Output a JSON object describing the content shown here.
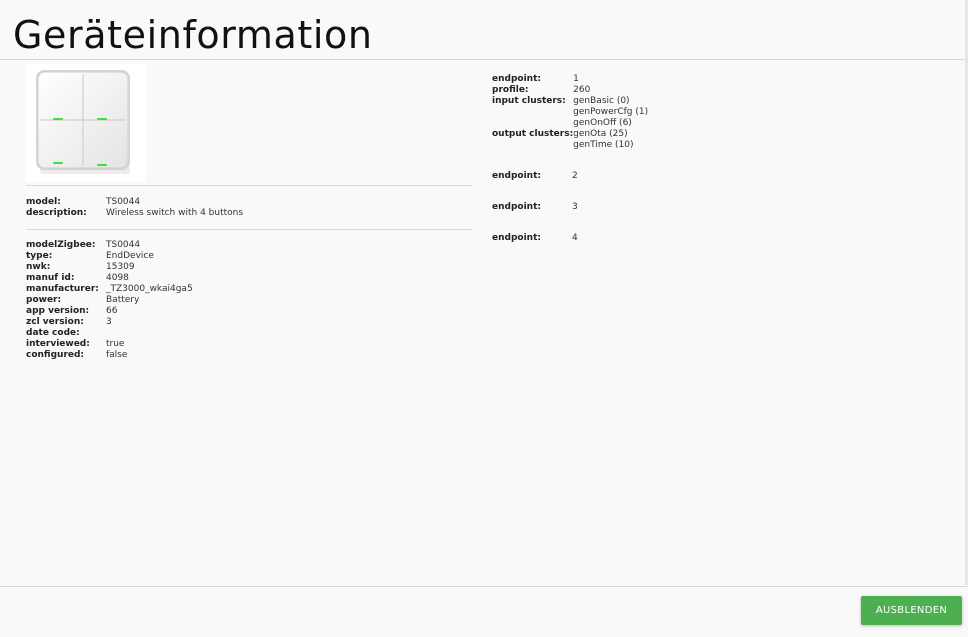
{
  "title": "Geräteinformation",
  "device": {
    "model_label": "model:",
    "model": "TS0044",
    "description_label": "description:",
    "description": "Wireless switch with 4 buttons",
    "info": [
      {
        "key": "modelZigbee:",
        "value": "TS0044"
      },
      {
        "key": "type:",
        "value": "EndDevice"
      },
      {
        "key": "nwk:",
        "value": "15309"
      },
      {
        "key": "manuf id:",
        "value": "4098"
      },
      {
        "key": "manufacturer:",
        "value": "_TZ3000_wkai4ga5"
      },
      {
        "key": "power:",
        "value": "Battery"
      },
      {
        "key": "app version:",
        "value": "66"
      },
      {
        "key": "zcl version:",
        "value": "3"
      },
      {
        "key": "date code:",
        "value": ""
      },
      {
        "key": "interviewed:",
        "value": "true"
      },
      {
        "key": "configured:",
        "value": "false"
      }
    ],
    "image_icon": "four-button-switch-image"
  },
  "endpoints": [
    {
      "endpoint_label": "endpoint:",
      "endpoint": "1",
      "profile_label": "profile:",
      "profile": "260",
      "input_label": "input clusters:",
      "input_clusters": [
        "genBasic (0)",
        "genPowerCfg (1)",
        "genOnOff (6)"
      ],
      "output_label": "output clusters:",
      "output_clusters": [
        "genOta (25)",
        "genTime (10)"
      ]
    },
    {
      "endpoint_label": "endpoint:",
      "endpoint": "2"
    },
    {
      "endpoint_label": "endpoint:",
      "endpoint": "3"
    },
    {
      "endpoint_label": "endpoint:",
      "endpoint": "4"
    }
  ],
  "footer": {
    "hide_button": "AUSBLENDEN"
  },
  "colors": {
    "accent_button": "#4caf50",
    "link": "#2b8fd6",
    "led": "#3be03b"
  }
}
